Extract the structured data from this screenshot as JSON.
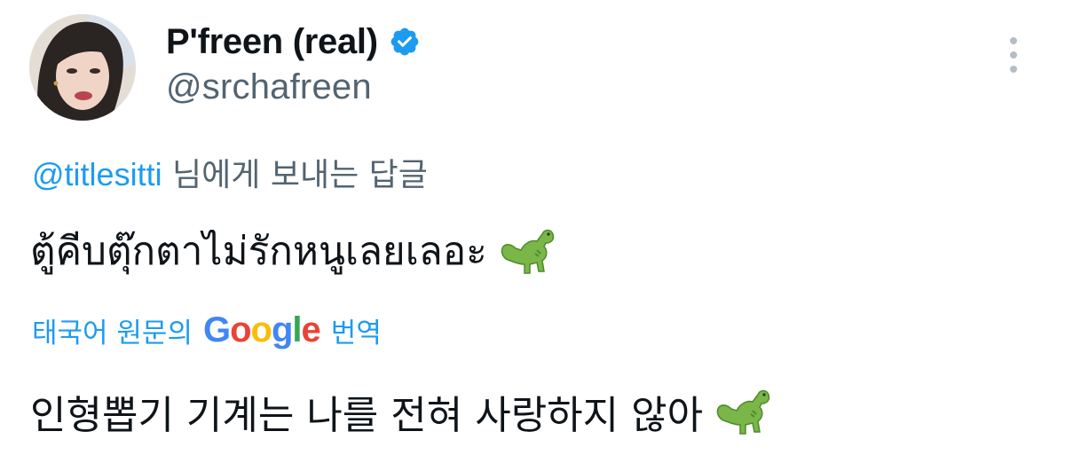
{
  "author": {
    "display_name": "P'freen (real)",
    "handle": "@srchafreen",
    "verified": true
  },
  "reply": {
    "mention": "@titlesitti",
    "suffix": " 님에게 보내는 답글"
  },
  "tweet": {
    "text": "ตู้คีบตุ๊กตาไม่รักหนูเลยเลอะ",
    "emoji": "t-rex-emoji"
  },
  "translation": {
    "prefix": "태국어 원문의",
    "brand": "Google",
    "suffix": "번역",
    "text": "인형뽑기 기계는 나를 전혀 사랑하지 않아"
  },
  "icons": {
    "verified": "verified-badge-icon",
    "more": "more-vertical-icon"
  },
  "colors": {
    "accent": "#1d9bf0",
    "secondary_text": "#536471",
    "primary_text": "#0f1419",
    "google_blue": "#4285f4",
    "google_red": "#ea4335",
    "google_yellow": "#fbbc05",
    "google_green": "#34a853"
  }
}
